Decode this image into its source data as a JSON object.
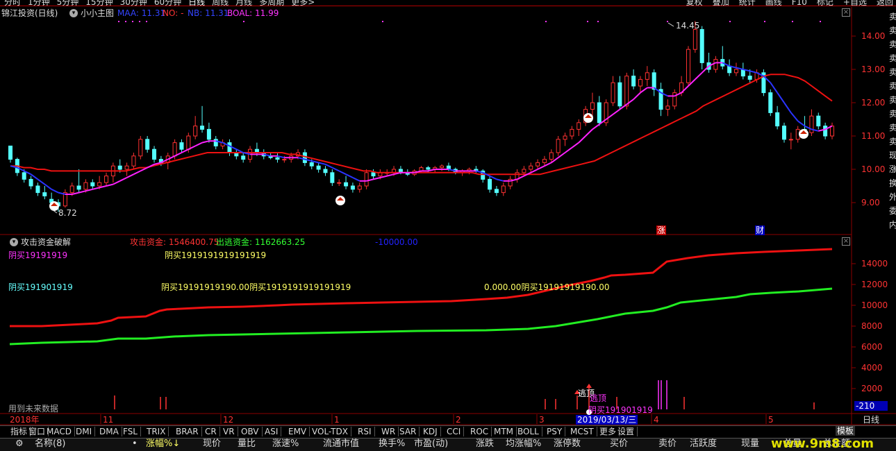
{
  "top_periods": [
    "分时",
    "1分钟",
    "5分钟",
    "15分钟",
    "30分钟",
    "60分钟",
    "日线",
    "周线",
    "月线",
    "多周期",
    "更多>"
  ],
  "top_right": [
    "复权",
    "叠加",
    "统计",
    "画线",
    "F10",
    "标记",
    "+自选",
    "返回"
  ],
  "main": {
    "title": "锦江投资(日线)",
    "indicator_name": "小小主图",
    "maa": "MAA: 11.31",
    "no": "NO: -",
    "nb": "NB: 11.31",
    "boal": "BOAL: 11.99",
    "high_label": "14.45",
    "low_label": "8.72",
    "yaxis": [
      "14.00",
      "13.00",
      "12.00",
      "11.00",
      "10.00",
      "9.00"
    ],
    "tag_zhang": "涨",
    "tag_cai": "财"
  },
  "sub": {
    "title": "攻击资金破解",
    "attack": "攻击资金: 1546400.75",
    "escape": "出逃资金: 1162663.25",
    "neg": "-10000.00",
    "t1": "阴买19191919",
    "t2": "阴买1919191919191919",
    "t3": "阴买191901919",
    "t4": "阴买19191919190.00阴买1919191919191919",
    "t5": "0.000.00阴买19191919190.00",
    "future": "用到未来数据",
    "escape_top": "逃顶",
    "escape_top2": "逃顶",
    "t6": "阴买191901919",
    "yaxis": [
      "14000",
      "12000",
      "10000",
      "8000",
      "6000",
      "4000",
      "2000"
    ],
    "cursor_value": "-210"
  },
  "timeline": {
    "year": "2018年",
    "months": [
      "11",
      "12",
      "1",
      "2",
      "3",
      "4",
      "5"
    ],
    "cursor_date": "2019/03/13/三",
    "period": "日线"
  },
  "indicator_tabs": [
    "指标",
    "窗口",
    "MACD",
    "DMI",
    "DMA",
    "FSL",
    "TRIX",
    "BRAR",
    "CR",
    "VR",
    "OBV",
    "ASI",
    "EMV",
    "VOL-TDX",
    "RSI",
    "WR",
    "SAR",
    "KDJ",
    "CCI",
    "ROC",
    "MTM",
    "BOLL",
    "PSY",
    "MCST",
    "更多",
    "设置"
  ],
  "template_label": "模板",
  "columns": [
    "名称(8)",
    "•",
    "涨幅%↓",
    "现价",
    "量比",
    "涨速%",
    "流通市值",
    "换手%",
    "市盈(动)",
    "涨跌",
    "均涨幅%",
    "涨停数",
    "买价",
    "卖价",
    "活跃度",
    "现量",
    "总量",
    "总金额"
  ],
  "watermark": "www.9m8.com",
  "side_text": "卖卖卖卖卖卖卖卖卖卖现涨换外委内",
  "colors": {
    "up": "#ff3232",
    "down": "#54ffff",
    "ma_red": "#ee1111",
    "ma_blue": "#2a34ff",
    "ma_mag": "#ff22ff",
    "green": "#22ee22",
    "grid": "#8b0000"
  },
  "chart_data": {
    "type": "candlestick",
    "title": "锦江投资(日线)",
    "ylim": [
      8.5,
      14.6
    ],
    "high": 14.45,
    "low": 8.72,
    "ohlc": [
      [
        10.7,
        10.7,
        10.2,
        10.3
      ],
      [
        10.3,
        10.35,
        9.8,
        9.9
      ],
      [
        9.9,
        10.0,
        9.6,
        9.7
      ],
      [
        9.7,
        9.8,
        9.4,
        9.5
      ],
      [
        9.5,
        9.6,
        9.2,
        9.3
      ],
      [
        9.3,
        9.5,
        9.1,
        9.2
      ],
      [
        9.1,
        9.3,
        8.9,
        9.0
      ],
      [
        9.0,
        9.1,
        8.72,
        8.9
      ],
      [
        8.9,
        9.4,
        8.85,
        9.3
      ],
      [
        9.3,
        9.6,
        9.2,
        9.5
      ],
      [
        9.5,
        10.0,
        9.3,
        9.4
      ],
      [
        9.4,
        9.7,
        9.3,
        9.6
      ],
      [
        9.6,
        9.7,
        9.4,
        9.5
      ],
      [
        9.5,
        9.8,
        9.4,
        9.6
      ],
      [
        9.6,
        9.9,
        9.5,
        9.8
      ],
      [
        9.8,
        10.2,
        9.6,
        10.1
      ],
      [
        10.1,
        10.3,
        9.9,
        10.0
      ],
      [
        10.0,
        10.2,
        9.8,
        10.1
      ],
      [
        10.1,
        10.5,
        10.0,
        10.4
      ],
      [
        10.4,
        11.0,
        10.3,
        10.9
      ],
      [
        10.9,
        11.0,
        10.5,
        10.6
      ],
      [
        10.6,
        10.7,
        10.2,
        10.3
      ],
      [
        10.3,
        10.4,
        10.1,
        10.2
      ],
      [
        10.2,
        10.5,
        10.0,
        10.4
      ],
      [
        10.4,
        10.9,
        10.3,
        10.8
      ],
      [
        10.8,
        10.9,
        10.5,
        10.6
      ],
      [
        10.6,
        11.1,
        10.5,
        11.0
      ],
      [
        11.0,
        11.6,
        10.9,
        11.3
      ],
      [
        11.3,
        11.9,
        11.1,
        11.2
      ],
      [
        11.2,
        11.4,
        10.8,
        10.9
      ],
      [
        10.9,
        11.0,
        10.6,
        10.7
      ],
      [
        10.7,
        10.9,
        10.6,
        10.8
      ],
      [
        10.8,
        10.9,
        10.4,
        10.5
      ],
      [
        10.5,
        10.6,
        10.3,
        10.4
      ],
      [
        10.4,
        10.5,
        10.2,
        10.3
      ],
      [
        10.3,
        10.7,
        10.2,
        10.6
      ],
      [
        10.6,
        10.8,
        10.4,
        10.5
      ],
      [
        10.5,
        10.6,
        10.3,
        10.4
      ],
      [
        10.4,
        10.5,
        10.3,
        10.35
      ],
      [
        10.35,
        10.5,
        10.2,
        10.3
      ],
      [
        10.3,
        10.4,
        10.2,
        10.3
      ],
      [
        10.3,
        10.5,
        10.2,
        10.4
      ],
      [
        10.4,
        10.6,
        10.3,
        10.5
      ],
      [
        10.5,
        10.6,
        10.1,
        10.2
      ],
      [
        10.2,
        10.3,
        10.0,
        10.1
      ],
      [
        10.1,
        10.2,
        9.9,
        10.0
      ],
      [
        10.0,
        10.1,
        9.8,
        9.9
      ],
      [
        9.9,
        10.0,
        9.5,
        9.6
      ],
      [
        9.6,
        9.7,
        9.5,
        9.6
      ],
      [
        9.6,
        9.8,
        9.4,
        9.5
      ],
      [
        9.5,
        9.6,
        9.3,
        9.4
      ],
      [
        9.4,
        9.6,
        9.3,
        9.5
      ],
      [
        9.5,
        10.0,
        9.4,
        9.9
      ],
      [
        9.9,
        10.0,
        9.7,
        9.8
      ],
      [
        9.8,
        10.0,
        9.7,
        9.9
      ],
      [
        9.9,
        10.0,
        9.8,
        9.9
      ],
      [
        9.9,
        10.1,
        9.8,
        10.0
      ],
      [
        10.0,
        10.1,
        9.85,
        9.9
      ],
      [
        9.9,
        10.0,
        9.8,
        9.85
      ],
      [
        9.85,
        10.0,
        9.8,
        9.95
      ],
      [
        9.95,
        10.1,
        9.9,
        10.05
      ],
      [
        10.05,
        10.1,
        9.9,
        10.0
      ],
      [
        10.0,
        10.1,
        9.9,
        10.05
      ],
      [
        10.05,
        10.15,
        9.95,
        10.1
      ],
      [
        10.1,
        10.2,
        9.95,
        10.0
      ],
      [
        10.0,
        10.05,
        9.85,
        9.9
      ],
      [
        9.9,
        10.0,
        9.8,
        9.95
      ],
      [
        9.95,
        10.05,
        9.85,
        10.0
      ],
      [
        10.0,
        10.1,
        9.9,
        9.95
      ],
      [
        9.95,
        10.0,
        9.6,
        9.7
      ],
      [
        9.7,
        9.8,
        9.3,
        9.4
      ],
      [
        9.4,
        9.5,
        9.2,
        9.3
      ],
      [
        9.3,
        9.6,
        9.2,
        9.5
      ],
      [
        9.5,
        9.8,
        9.4,
        9.7
      ],
      [
        9.7,
        10.0,
        9.6,
        9.9
      ],
      [
        9.9,
        10.1,
        9.8,
        10.0
      ],
      [
        10.0,
        10.2,
        9.9,
        10.1
      ],
      [
        10.1,
        10.3,
        10.0,
        10.2
      ],
      [
        10.2,
        10.4,
        10.1,
        10.3
      ],
      [
        10.3,
        10.6,
        10.2,
        10.5
      ],
      [
        10.5,
        11.0,
        10.4,
        10.9
      ],
      [
        10.9,
        11.1,
        10.7,
        11.0
      ],
      [
        11.0,
        11.3,
        10.9,
        11.2
      ],
      [
        11.2,
        11.5,
        11.0,
        11.4
      ],
      [
        11.4,
        11.9,
        11.3,
        11.8
      ],
      [
        11.8,
        12.3,
        11.5,
        12.0
      ],
      [
        12.0,
        12.2,
        11.3,
        11.4
      ],
      [
        11.4,
        12.1,
        11.3,
        12.0
      ],
      [
        12.0,
        12.8,
        11.9,
        12.6
      ],
      [
        12.6,
        12.8,
        11.8,
        11.9
      ],
      [
        11.9,
        12.9,
        11.8,
        12.8
      ],
      [
        12.8,
        13.0,
        12.4,
        12.5
      ],
      [
        12.5,
        12.8,
        12.3,
        12.7
      ],
      [
        12.7,
        13.1,
        12.5,
        12.9
      ],
      [
        12.9,
        13.0,
        12.2,
        12.4
      ],
      [
        12.4,
        12.6,
        11.6,
        11.8
      ],
      [
        11.8,
        12.1,
        11.6,
        11.9
      ],
      [
        11.9,
        12.4,
        11.8,
        12.3
      ],
      [
        12.3,
        12.8,
        12.2,
        12.6
      ],
      [
        12.6,
        13.7,
        12.5,
        13.6
      ],
      [
        13.6,
        14.45,
        13.5,
        14.2
      ],
      [
        14.2,
        14.3,
        13.0,
        13.2
      ],
      [
        13.2,
        13.5,
        12.9,
        13.0
      ],
      [
        13.0,
        13.4,
        12.9,
        13.3
      ],
      [
        13.3,
        13.7,
        13.0,
        13.1
      ],
      [
        13.1,
        13.3,
        12.8,
        12.9
      ],
      [
        12.9,
        13.2,
        12.8,
        13.0
      ],
      [
        13.0,
        13.2,
        12.7,
        12.8
      ],
      [
        12.8,
        13.0,
        12.6,
        12.7
      ],
      [
        12.7,
        13.0,
        12.6,
        12.9
      ],
      [
        12.9,
        13.0,
        12.2,
        12.3
      ],
      [
        12.3,
        12.4,
        11.6,
        11.7
      ],
      [
        11.7,
        11.9,
        11.2,
        11.3
      ],
      [
        11.3,
        11.4,
        10.8,
        10.9
      ],
      [
        10.9,
        11.1,
        10.6,
        10.9
      ],
      [
        10.9,
        11.3,
        10.8,
        11.2
      ],
      [
        11.2,
        11.6,
        11.0,
        11.1
      ],
      [
        11.1,
        11.8,
        11.0,
        11.6
      ],
      [
        11.6,
        11.7,
        11.2,
        11.3
      ],
      [
        11.3,
        11.4,
        10.9,
        11.0
      ],
      [
        11.0,
        11.4,
        10.9,
        11.3
      ]
    ],
    "ma_long": [
      10.1,
      10.1,
      10.05,
      10.05,
      10.0,
      10.0,
      9.95,
      9.95,
      9.95,
      9.95,
      9.95,
      9.95,
      9.95,
      9.95,
      9.95,
      9.95,
      9.95,
      9.95,
      10.0,
      10.05,
      10.05,
      10.1,
      10.15,
      10.2,
      10.25,
      10.3,
      10.35,
      10.4,
      10.45,
      10.5,
      10.5,
      10.5,
      10.5,
      10.5,
      10.5,
      10.5,
      10.5,
      10.5,
      10.5,
      10.5,
      10.5,
      10.45,
      10.45,
      10.4,
      10.35,
      10.3,
      10.25,
      10.2,
      10.15,
      10.1,
      10.05,
      10.0,
      9.95,
      9.95,
      9.9,
      9.9,
      9.9,
      9.9,
      9.9,
      9.9,
      9.9,
      9.9,
      9.9,
      9.9,
      9.9,
      9.9,
      9.9,
      9.9,
      9.9,
      9.85,
      9.85,
      9.85,
      9.85,
      9.85,
      9.85,
      9.85,
      9.85,
      9.85,
      9.85,
      9.9,
      9.95,
      10.0,
      10.05,
      10.1,
      10.15,
      10.2,
      10.25,
      10.35,
      10.45,
      10.55,
      10.65,
      10.75,
      10.85,
      10.95,
      11.05,
      11.15,
      11.25,
      11.35,
      11.45,
      11.55,
      11.65,
      11.75,
      11.9,
      12.0,
      12.1,
      12.2,
      12.3,
      12.4,
      12.5,
      12.6,
      12.7,
      12.8,
      12.85,
      12.85,
      12.85,
      12.8,
      12.75,
      12.65,
      12.5,
      12.35,
      12.2,
      12.05
    ],
    "ma_short": [
      10.1,
      10.05,
      9.95,
      9.85,
      9.7,
      9.55,
      9.4,
      9.3,
      9.25,
      9.25,
      9.3,
      9.35,
      9.4,
      9.45,
      9.5,
      9.55,
      9.65,
      9.75,
      9.85,
      9.95,
      10.05,
      10.15,
      10.2,
      10.3,
      10.4,
      10.5,
      10.6,
      10.7,
      10.8,
      10.85,
      10.85,
      10.8,
      10.7,
      10.6,
      10.5,
      10.45,
      10.45,
      10.45,
      10.4,
      10.4,
      10.35,
      10.35,
      10.35,
      10.3,
      10.25,
      10.2,
      10.15,
      10.05,
      9.95,
      9.85,
      9.75,
      9.65,
      9.65,
      9.7,
      9.75,
      9.8,
      9.85,
      9.9,
      9.9,
      9.9,
      9.95,
      9.95,
      10.0,
      10.0,
      10.0,
      9.95,
      9.95,
      9.95,
      9.95,
      9.9,
      9.8,
      9.7,
      9.65,
      9.65,
      9.7,
      9.8,
      9.9,
      10.0,
      10.1,
      10.2,
      10.35,
      10.5,
      10.65,
      10.8,
      11.0,
      11.2,
      11.35,
      11.5,
      11.65,
      11.8,
      11.95,
      12.1,
      12.3,
      12.45,
      12.45,
      12.3,
      12.2,
      12.2,
      12.3,
      12.5,
      12.7,
      12.9,
      13.1,
      13.2,
      13.2,
      13.1,
      13.05,
      13.0,
      12.95,
      12.9,
      12.8,
      12.6,
      12.3,
      12.0,
      11.7,
      11.45,
      11.3,
      11.2,
      11.15,
      11.2,
      11.3
    ]
  }
}
